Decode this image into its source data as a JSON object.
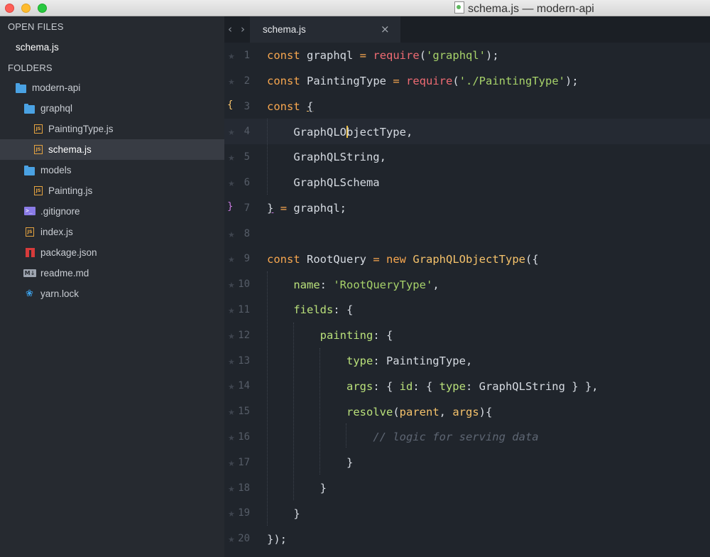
{
  "window": {
    "title": "schema.js — modern-api"
  },
  "sidebar": {
    "open_files_header": "OPEN FILES",
    "open_files": [
      {
        "name": "schema.js"
      }
    ],
    "folders_header": "FOLDERS",
    "tree": [
      {
        "name": "modern-api",
        "icon": "folder-icon"
      },
      {
        "name": "graphql",
        "icon": "folder-icon"
      },
      {
        "name": "PaintingType.js",
        "icon": "js-file-icon"
      },
      {
        "name": "schema.js",
        "icon": "js-file-icon"
      },
      {
        "name": "models",
        "icon": "folder-icon"
      },
      {
        "name": "Painting.js",
        "icon": "js-file-icon"
      },
      {
        "name": ".gitignore",
        "icon": "terminal-file-icon"
      },
      {
        "name": "index.js",
        "icon": "js-file-icon"
      },
      {
        "name": "package.json",
        "icon": "npm-package-icon"
      },
      {
        "name": "readme.md",
        "icon": "markdown-icon"
      },
      {
        "name": "yarn.lock",
        "icon": "yarn-icon"
      }
    ]
  },
  "tabs": [
    {
      "label": "schema.js",
      "close": "×"
    }
  ],
  "nav": {
    "back": "‹",
    "forward": "›"
  },
  "editor": {
    "gutter_bracket_open": "{",
    "gutter_bracket_close": "}",
    "line_numbers": [
      "1",
      "2",
      "3",
      "4",
      "5",
      "6",
      "7",
      "8",
      "9",
      "10",
      "11",
      "12",
      "13",
      "14",
      "15",
      "16",
      "17",
      "18",
      "19",
      "20"
    ],
    "lines": [
      "const graphql = require('graphql');",
      "const PaintingType = require('./PaintingType');",
      "const {",
      "    GraphQLObjectType,",
      "    GraphQLString,",
      "    GraphQLSchema",
      "} = graphql;",
      "",
      "const RootQuery = new GraphQLObjectType({",
      "    name: 'RootQueryType',",
      "    fields: {",
      "        painting: {",
      "            type: PaintingType,",
      "            args: { id: { type: GraphQLString } },",
      "            resolve(parent, args){",
      "                // logic for serving data",
      "            }",
      "        }",
      "    }",
      "});"
    ]
  },
  "colors": {
    "keyword": "#f8a74f",
    "string": "#a7d26a",
    "function": "#f5c26b",
    "property": "#b9e07a",
    "comment": "#5e6673",
    "background": "#20252c",
    "sidebar": "#262a30"
  }
}
